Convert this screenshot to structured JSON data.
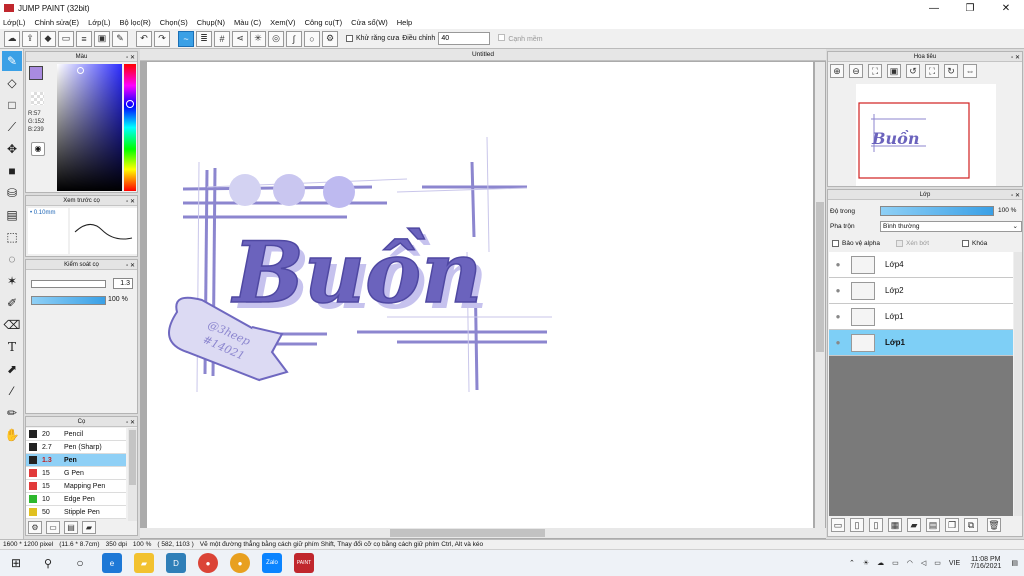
{
  "window": {
    "title": "JUMP PAINT (32bit)",
    "minimize": "—",
    "restore": "❐",
    "close": "✕"
  },
  "menu": [
    "Lớp(L)",
    "Chỉnh sửa(E)",
    "Lớp(L)",
    "Bộ lọc(R)",
    "Chọn(S)",
    "Chụp(N)",
    "Màu (C)",
    "Xem(V)",
    "Công cụ(T)",
    "Cửa sổ(W)",
    "Help"
  ],
  "toolbar": {
    "antialias_label": "Khử răng cưa",
    "adjust_label": "Điều chỉnh",
    "adjust_value": "40",
    "edge_label": "Cạnh mềm"
  },
  "color_panel": {
    "title": "Màu",
    "r": "R:57",
    "g": "G:152",
    "b": "B:239",
    "fg": "#a98be0"
  },
  "brush_preview": {
    "title": "Xem trước cọ",
    "size": "0.10mm"
  },
  "brush_control": {
    "title": "Kiểm soát cọ",
    "size_value": "1.3",
    "opacity_value": "100 %"
  },
  "brush_list": {
    "title": "Cọ",
    "items": [
      {
        "size": "20",
        "name": "Pencil",
        "color": "#222222"
      },
      {
        "size": "2.7",
        "name": "Pen (Sharp)",
        "color": "#222222"
      },
      {
        "size": "1.3",
        "name": "Pen",
        "color": "#222222",
        "selected": true
      },
      {
        "size": "15",
        "name": "G Pen",
        "color": "#e23a3a"
      },
      {
        "size": "15",
        "name": "Mapping Pen",
        "color": "#e23a3a"
      },
      {
        "size": "10",
        "name": "Edge Pen",
        "color": "#2db82d"
      },
      {
        "size": "50",
        "name": "Stipple Pen",
        "color": "#e0c020"
      }
    ]
  },
  "canvas": {
    "tab_title": "Untitled",
    "artwork": {
      "word": "Buồn",
      "ribbon_text_1": "@3heep",
      "ribbon_text_2": "#14021"
    }
  },
  "navigator": {
    "title": "Hoa tiêu"
  },
  "layers": {
    "title": "Lớp",
    "opacity_label": "Độ trong",
    "opacity_value": "100 %",
    "blend_label": "Pha trộn",
    "blend_value": "Bình thường",
    "protect_alpha": "Bảo vệ alpha",
    "clipping": "Xén bớt",
    "lock": "Khóa",
    "items": [
      {
        "name": "Lớp4",
        "selected": false
      },
      {
        "name": "Lớp2",
        "selected": false
      },
      {
        "name": "Lớp1",
        "selected": false
      },
      {
        "name": "Lớp1",
        "selected": true
      }
    ]
  },
  "status": {
    "size": "1600 * 1200 pixel",
    "cm": "(11.6 * 8.7cm)",
    "dpi": "350 dpi",
    "zoom": "100 %",
    "coords": "( 582, 1103 )",
    "hint": "Vẽ một đường thẳng bằng cách giữ phím Shift, Thay đổi cỡ cọ bằng cách giữ phím Ctrl, Alt và kéo"
  },
  "taskbar": {
    "lang": "VIE",
    "time": "11:08 PM",
    "date": "7/16/2021"
  }
}
